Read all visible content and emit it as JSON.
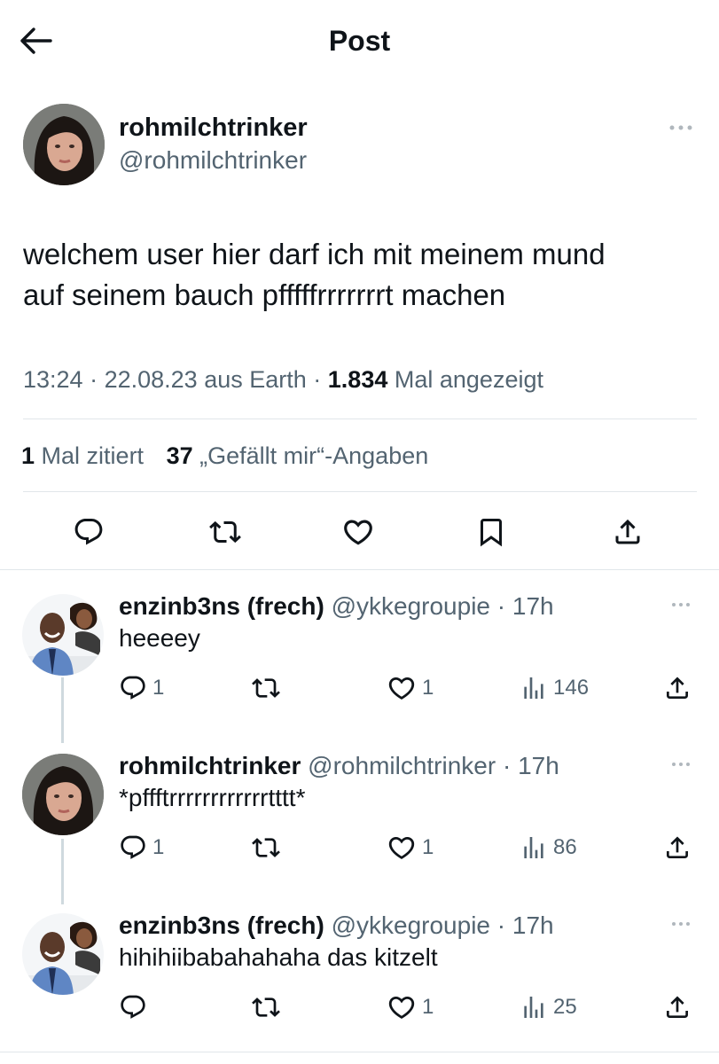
{
  "header": {
    "title": "Post"
  },
  "post": {
    "display_name": "rohmilchtrinker",
    "handle": "@rohmilchtrinker",
    "text_line1": "welchem user hier darf ich mit meinem mund",
    "text_line2": "auf seinem bauch pfffffrrrrrrrt machen",
    "time": "13:24",
    "date": "22.08.23",
    "source": "aus Earth",
    "views_count": "1.834",
    "views_label": "Mal angezeigt",
    "quotes_count": "1",
    "quotes_label": "Mal zitiert",
    "likes_count": "37",
    "likes_label": "„Gefällt mir“-Angaben",
    "actions": [
      "reply-icon",
      "repost-icon",
      "like-icon",
      "bookmark-icon",
      "share-icon"
    ]
  },
  "replies": [
    {
      "display_name": "enzinb3ns (frech)",
      "handle": "@ykkegroupie",
      "time": "· 17h",
      "text": "heeeey",
      "reply_count": "1",
      "repost_count": "",
      "like_count": "1",
      "view_count": "146"
    },
    {
      "display_name": "rohmilchtrinker",
      "handle": "@rohmilchtrinker",
      "time": "· 17h",
      "text": "*pffftrrrrrrrrrrrrtttt*",
      "reply_count": "1",
      "repost_count": "",
      "like_count": "1",
      "view_count": "86"
    },
    {
      "display_name": "enzinb3ns (frech)",
      "handle": "@ykkegroupie",
      "time": "· 17h",
      "text": "hihihiibabahahaha das kitzelt",
      "reply_count": "",
      "repost_count": "",
      "like_count": "1",
      "view_count": "25"
    }
  ],
  "colors": {
    "text_primary": "#0f1419",
    "text_secondary": "#536471",
    "divider": "#e1e6ea",
    "thread_line": "#cfd9de"
  }
}
